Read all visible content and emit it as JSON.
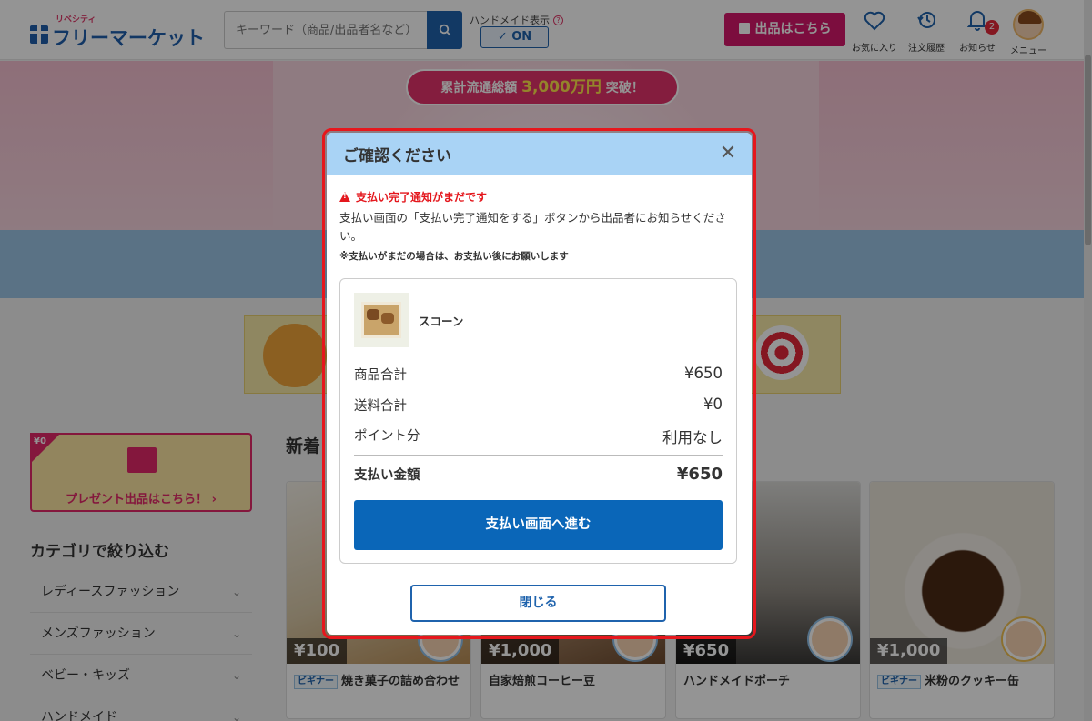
{
  "header": {
    "logo_tag": "リベシティ",
    "logo_name": "フリーマーケット",
    "search_placeholder": "キーワード（商品/出品者名など）",
    "handmade_label": "ハンドメイド表示",
    "handmade_toggle": "✓ ON",
    "sell_button": "出品はこちら",
    "icons": [
      {
        "label": "お気に入り",
        "icon": "heart-icon"
      },
      {
        "label": "注文履歴",
        "icon": "history-icon"
      },
      {
        "label": "お知らせ",
        "icon": "bell-icon",
        "badge": "2"
      },
      {
        "label": "メニュー",
        "icon": "avatar"
      }
    ]
  },
  "hero": {
    "pill_prefix": "累計流通総額",
    "pill_amount": "3,000万円",
    "pill_suffix": "突破！"
  },
  "sidebar": {
    "present_badge": "¥0",
    "present_label": "プレゼント出品はこちら！ ›",
    "category_title": "カテゴリで絞り込む",
    "categories": [
      "レディースファッション",
      "メンズファッション",
      "ベビー・キッズ",
      "ハンドメイド"
    ]
  },
  "main": {
    "section_title": "新着",
    "cards": [
      {
        "price": "¥100",
        "beginner": "ビギナー",
        "title": "焼き菓子の詰め合わせ"
      },
      {
        "price": "¥1,000",
        "beginner": "",
        "title": "自家焙煎コーヒー豆"
      },
      {
        "price": "¥650",
        "beginner": "",
        "title": "ハンドメイドポーチ"
      },
      {
        "price": "¥1,000",
        "beginner": "ビギナー",
        "title": "米粉のクッキー缶"
      }
    ]
  },
  "modal": {
    "title": "ご確認ください",
    "close_symbol": "✕",
    "warning": "支払い完了通知がまだです",
    "message": "支払い画面の「支払い完了通知をする」ボタンから出品者にお知らせください。",
    "note": "※支払いがまだの場合は、お支払い後にお願いします",
    "product_name": "スコーン",
    "rows": [
      {
        "label": "商品合計",
        "value": "¥650"
      },
      {
        "label": "送料合計",
        "value": "¥0"
      },
      {
        "label": "ポイント分",
        "value": "利用なし"
      }
    ],
    "total_label": "支払い金額",
    "total_value": "¥650",
    "pay_button": "支払い画面へ進む",
    "close_button": "閉じる"
  },
  "colors": {
    "brand_blue": "#1f63ad",
    "sell_pink": "#d6186b",
    "modal_header": "#a9d3f5",
    "warning_red": "#e4171d",
    "primary_button": "#0a66b8"
  }
}
